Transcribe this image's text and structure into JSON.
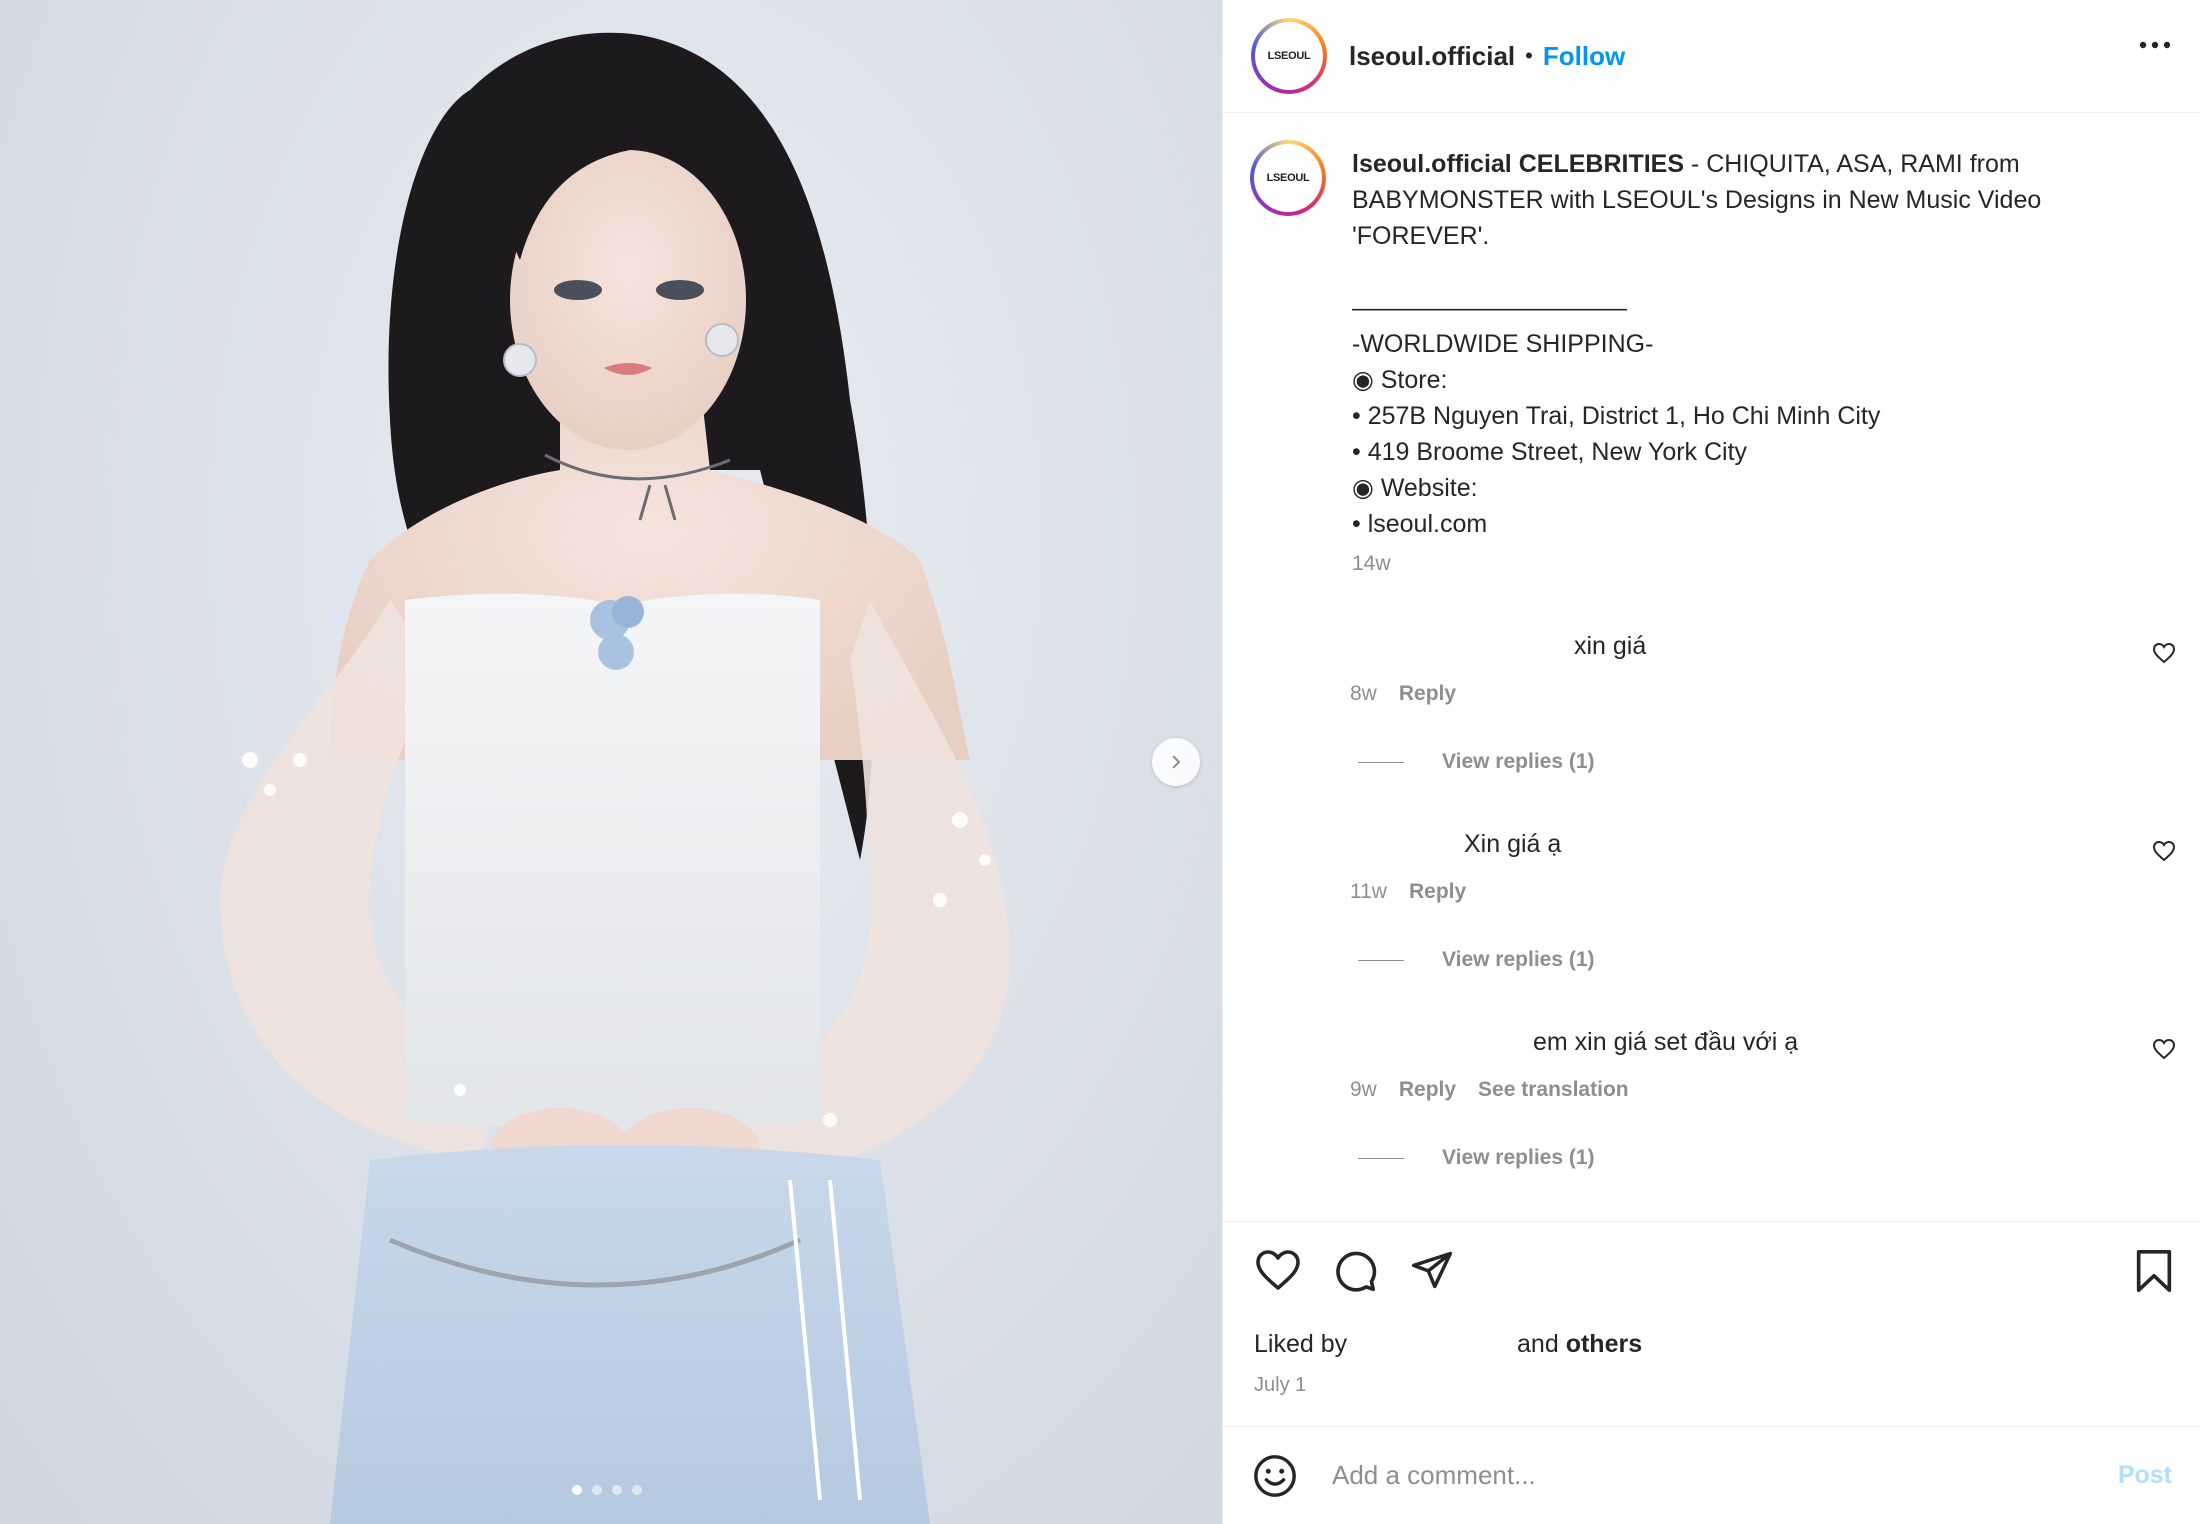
{
  "header": {
    "avatar_text": "LSEOUL",
    "username": "lseoul.official",
    "separator": "•",
    "follow_label": "Follow",
    "more_icon": "more-horizontal-icon"
  },
  "caption": {
    "username": "lseoul.official",
    "headline": "CELEBRITIES",
    "text": " - CHIQUITA, ASA, RAMI from BABYMONSTER with LSEOUL's Designs in New Music Video 'FOREVER'.",
    "divider": "———————————",
    "lines": [
      "-WORLDWIDE SHIPPING-",
      "◉ Store:",
      "• 257B Nguyen Trai, District 1, Ho Chi Minh City",
      "• 419 Broome Street, New York City",
      "◉ Website:",
      "• lseoul.com"
    ],
    "time": "14w"
  },
  "comments": [
    {
      "text": "xin giá",
      "time": "8w",
      "reply_label": "Reply",
      "translate_label": "",
      "view_replies": "View replies (1)"
    },
    {
      "text": "Xin giá ạ",
      "time": "11w",
      "reply_label": "Reply",
      "translate_label": "",
      "view_replies": "View replies (1)"
    },
    {
      "text": "em xin giá set đầu với ạ",
      "time": "9w",
      "reply_label": "Reply",
      "translate_label": "See translation",
      "view_replies": "View replies (1)"
    }
  ],
  "actions": {
    "like_icon": "heart-icon",
    "comment_icon": "comment-icon",
    "share_icon": "send-icon",
    "save_icon": "bookmark-icon",
    "liked_prefix": "Liked by",
    "liked_middle": "and",
    "liked_others": "others",
    "date": "July 1"
  },
  "add_comment": {
    "emoji_icon": "emoji-icon",
    "placeholder": "Add a comment...",
    "post_label": "Post"
  },
  "media": {
    "next_icon": "chevron-right-icon",
    "carousel_count": 4,
    "carousel_active": 1
  },
  "colors": {
    "accent": "#0095f6",
    "post_disabled": "#b2dffc",
    "muted": "#8e8e8e",
    "text": "#262626"
  }
}
